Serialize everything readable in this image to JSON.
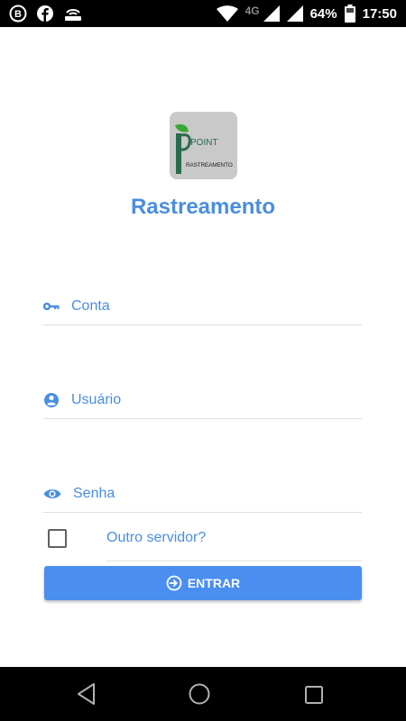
{
  "status_bar": {
    "network": "4G",
    "battery": "64%",
    "time": "17:50",
    "icons": [
      "b-circle-icon",
      "facebook-icon",
      "router-icon",
      "wifi-icon",
      "signal-icon",
      "signal-icon-2",
      "battery-icon"
    ]
  },
  "logo": {
    "alt": "Point Rastreamento logo",
    "line1": "POINT",
    "line2": "RASTREAMENTO"
  },
  "app": {
    "title": "Rastreamento",
    "accent_color": "#4a8ee0",
    "button_color": "#4a8ef0"
  },
  "form": {
    "conta": {
      "placeholder": "Conta",
      "icon": "key-icon"
    },
    "usuario": {
      "placeholder": "Usuário",
      "icon": "account-circle-icon"
    },
    "senha": {
      "placeholder": "Senha",
      "icon": "eye-icon"
    },
    "other_server": {
      "label": "Outro servidor?",
      "checked": false
    },
    "submit": {
      "label": "ENTRAR",
      "icon": "login-icon"
    }
  },
  "nav_bar": {
    "buttons": [
      "back-icon",
      "home-icon",
      "recents-icon"
    ]
  }
}
